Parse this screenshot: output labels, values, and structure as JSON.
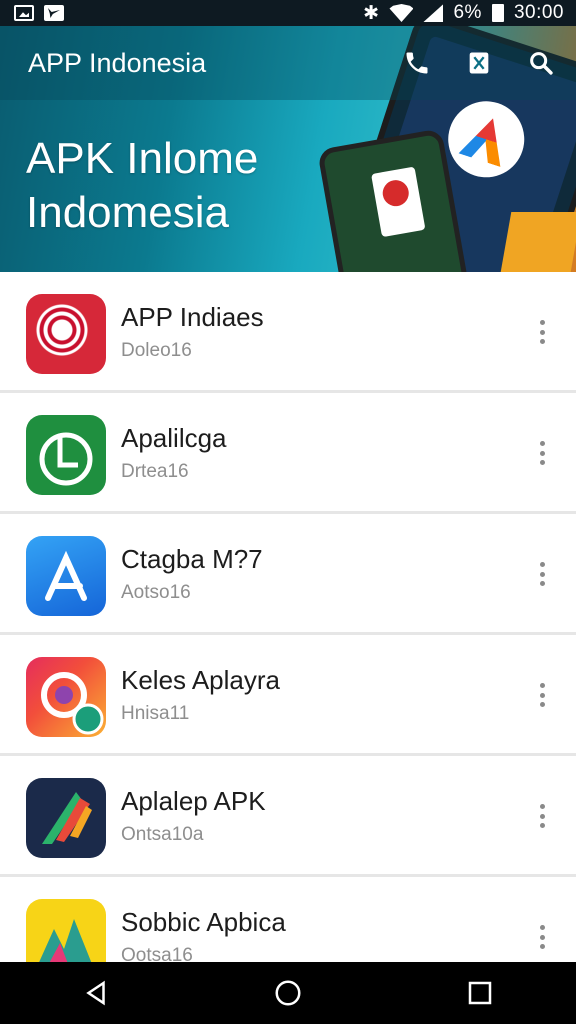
{
  "status_bar": {
    "battery_text": "6%",
    "time": "30:00"
  },
  "app_bar": {
    "title": "APP Indonesia",
    "icons": [
      "phone-icon",
      "bookmark-icon",
      "search-icon"
    ]
  },
  "hero": {
    "line1": "APK Inlome",
    "line2": "Indomesia"
  },
  "apps": [
    {
      "name": "APP Indiaes",
      "sub": "Doleo16",
      "icon": "red-target-app-icon"
    },
    {
      "name": "Apalilcga",
      "sub": "Drtea16",
      "icon": "green-app-icon"
    },
    {
      "name": "Ctagba M?7",
      "sub": "Aotso16",
      "icon": "blue-app-store-icon"
    },
    {
      "name": "Keles Aplayra",
      "sub": "Hnisa11",
      "icon": "camera-app-icon"
    },
    {
      "name": "Aplalep APK",
      "sub": "Ontsa10a",
      "icon": "dark-navy-app-icon"
    },
    {
      "name": "Sobbic Apbica",
      "sub": "Ootsa16",
      "icon": "yellow-app-icon"
    }
  ],
  "nav": [
    "back-icon",
    "home-icon",
    "recents-icon"
  ]
}
